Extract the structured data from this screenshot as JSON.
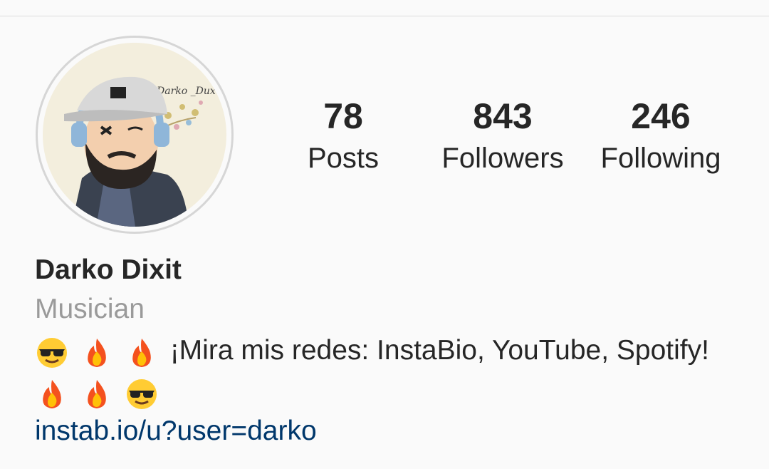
{
  "profile": {
    "avatar_icon": "profile-avatar-illustration",
    "avatar_caption": "Darko _Dux",
    "name": "Darko Dixit",
    "category": "Musician",
    "bio_text": "¡Mira mis redes: InstaBio, YouTube, Spotify!",
    "bio_emojis_leading": [
      "sunglasses-emoji",
      "fire-emoji",
      "fire-emoji"
    ],
    "bio_emojis_trailing": [
      "fire-emoji",
      "fire-emoji",
      "sunglasses-emoji"
    ],
    "link": "instab.io/u?user=darko"
  },
  "stats": {
    "posts": {
      "value": "78",
      "label": "Posts"
    },
    "followers": {
      "value": "843",
      "label": "Followers"
    },
    "following": {
      "value": "246",
      "label": "Following"
    }
  },
  "colors": {
    "background": "#fafafa",
    "text": "#262626",
    "muted": "#9a9a9a",
    "link": "#00376b",
    "divider": "#dcdcdc"
  }
}
